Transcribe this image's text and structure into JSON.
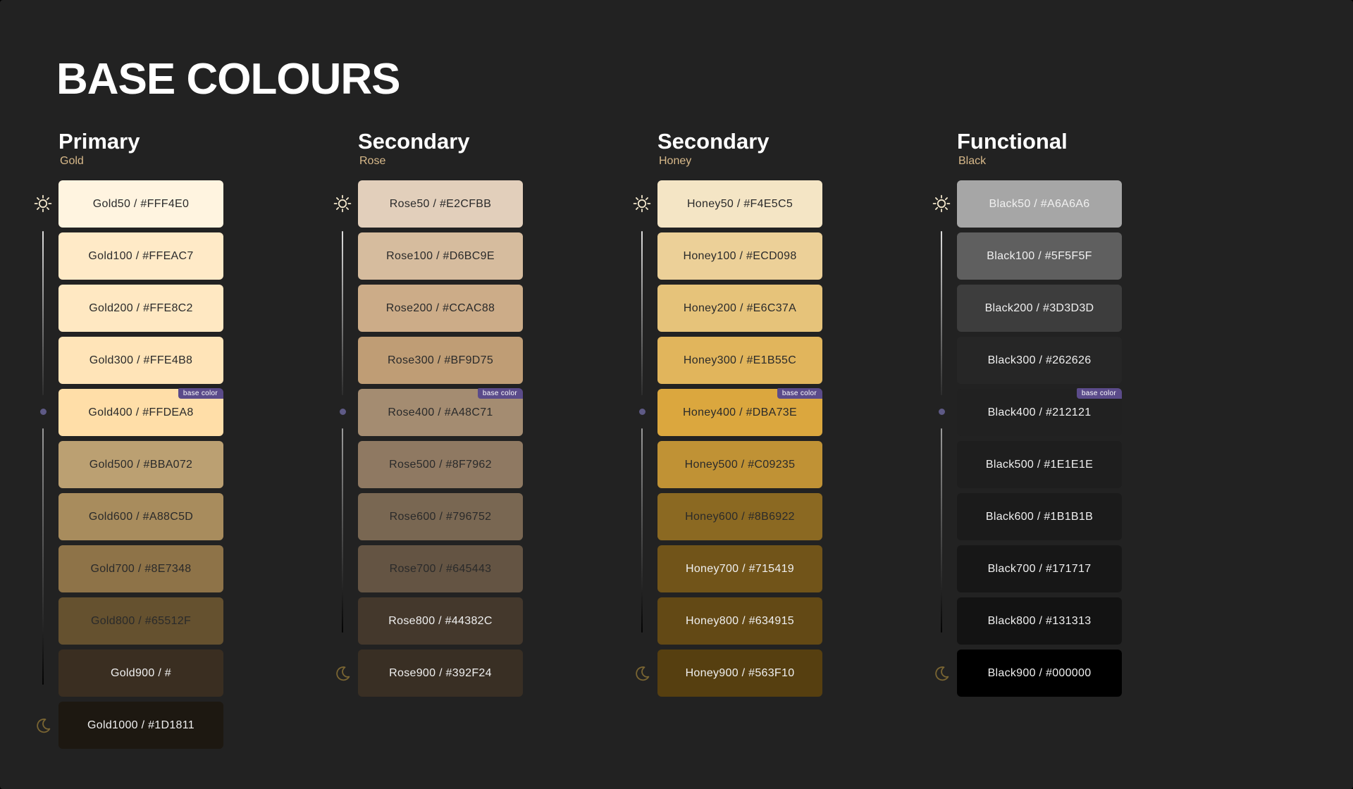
{
  "page": {
    "title": "BASE COLOURS",
    "badge_label": "base color"
  },
  "groups": [
    {
      "title": "Primary",
      "subtitle": "Gold",
      "swatches": [
        {
          "label": "Gold50 / #FFF4E0",
          "color": "#FFF4E0",
          "text": "#2a2a2a",
          "base": false
        },
        {
          "label": "Gold100 / #FFEAC7",
          "color": "#FFEAC7",
          "text": "#2a2a2a",
          "base": false
        },
        {
          "label": "Gold200 / #FFE8C2",
          "color": "#FFE8C2",
          "text": "#2a2a2a",
          "base": false
        },
        {
          "label": "Gold300 / #FFE4B8",
          "color": "#FFE4B8",
          "text": "#2a2a2a",
          "base": false
        },
        {
          "label": "Gold400 / #FFDEA8",
          "color": "#FFDEA8",
          "text": "#2a2a2a",
          "base": true
        },
        {
          "label": "Gold500 / #BBA072",
          "color": "#BBA072",
          "text": "#2a2a2a",
          "base": false
        },
        {
          "label": "Gold600 / #A88C5D",
          "color": "#A88C5D",
          "text": "#2a2a2a",
          "base": false
        },
        {
          "label": "Gold700 / #8E7348",
          "color": "#8E7348",
          "text": "#2a2a2a",
          "base": false
        },
        {
          "label": "Gold800 / #65512F",
          "color": "#65512F",
          "text": "#2a2a2a",
          "base": false
        },
        {
          "label": "Gold900 / #",
          "color": "#3A2E21",
          "text": "#f0f0f0",
          "base": false
        },
        {
          "label": "Gold1000 / #1D1811",
          "color": "#1D1811",
          "text": "#f0f0f0",
          "base": false
        }
      ]
    },
    {
      "title": "Secondary",
      "subtitle": "Rose",
      "swatches": [
        {
          "label": "Rose50 / #E2CFBB",
          "color": "#E2CFBB",
          "text": "#2a2a2a",
          "base": false
        },
        {
          "label": "Rose100 / #D6BC9E",
          "color": "#D6BC9E",
          "text": "#2a2a2a",
          "base": false
        },
        {
          "label": "Rose200 / #CCAC88",
          "color": "#CCAC88",
          "text": "#2a2a2a",
          "base": false
        },
        {
          "label": "Rose300 / #BF9D75",
          "color": "#BF9D75",
          "text": "#2a2a2a",
          "base": false
        },
        {
          "label": "Rose400 / #A48C71",
          "color": "#A48C71",
          "text": "#2a2a2a",
          "base": true
        },
        {
          "label": "Rose500 / #8F7962",
          "color": "#8F7962",
          "text": "#2a2a2a",
          "base": false
        },
        {
          "label": "Rose600 / #796752",
          "color": "#796752",
          "text": "#2a2a2a",
          "base": false
        },
        {
          "label": "Rose700 / #645443",
          "color": "#645443",
          "text": "#2a2a2a",
          "base": false
        },
        {
          "label": "Rose800 / #44382C",
          "color": "#44382C",
          "text": "#f0f0f0",
          "base": false
        },
        {
          "label": "Rose900 / #392F24",
          "color": "#392F24",
          "text": "#f0f0f0",
          "base": false
        }
      ]
    },
    {
      "title": "Secondary",
      "subtitle": "Honey",
      "swatches": [
        {
          "label": "Honey50 / #F4E5C5",
          "color": "#F4E5C5",
          "text": "#2a2a2a",
          "base": false
        },
        {
          "label": "Honey100 / #ECD098",
          "color": "#ECD098",
          "text": "#2a2a2a",
          "base": false
        },
        {
          "label": "Honey200 / #E6C37A",
          "color": "#E6C37A",
          "text": "#2a2a2a",
          "base": false
        },
        {
          "label": "Honey300 / #E1B55C",
          "color": "#E1B55C",
          "text": "#2a2a2a",
          "base": false
        },
        {
          "label": "Honey400 / #DBA73E",
          "color": "#DBA73E",
          "text": "#2a2a2a",
          "base": true
        },
        {
          "label": "Honey500 / #C09235",
          "color": "#C09235",
          "text": "#2a2a2a",
          "base": false
        },
        {
          "label": "Honey600 / #8B6922",
          "color": "#8B6922",
          "text": "#2a2a2a",
          "base": false
        },
        {
          "label": "Honey700 / #715419",
          "color": "#715419",
          "text": "#f0f0f0",
          "base": false
        },
        {
          "label": "Honey800 / #634915",
          "color": "#634915",
          "text": "#f0f0f0",
          "base": false
        },
        {
          "label": "Honey900 / #563F10",
          "color": "#563F10",
          "text": "#f0f0f0",
          "base": false
        }
      ]
    },
    {
      "title": "Functional",
      "subtitle": "Black",
      "swatches": [
        {
          "label": "Black50 / #A6A6A6",
          "color": "#A6A6A6",
          "text": "#f0f0f0",
          "base": false
        },
        {
          "label": "Black100 / #5F5F5F",
          "color": "#5F5F5F",
          "text": "#f0f0f0",
          "base": false
        },
        {
          "label": "Black200 / #3D3D3D",
          "color": "#3D3D3D",
          "text": "#f0f0f0",
          "base": false
        },
        {
          "label": "Black300 / #262626",
          "color": "#262626",
          "text": "#f0f0f0",
          "base": false
        },
        {
          "label": "Black400 / #212121",
          "color": "#212121",
          "text": "#f0f0f0",
          "base": true
        },
        {
          "label": "Black500 / #1E1E1E",
          "color": "#1E1E1E",
          "text": "#f0f0f0",
          "base": false
        },
        {
          "label": "Black600 / #1B1B1B",
          "color": "#1B1B1B",
          "text": "#f0f0f0",
          "base": false
        },
        {
          "label": "Black700 / #171717",
          "color": "#171717",
          "text": "#f0f0f0",
          "base": false
        },
        {
          "label": "Black800 / #131313",
          "color": "#131313",
          "text": "#f0f0f0",
          "base": false
        },
        {
          "label": "Black900 / #000000",
          "color": "#000000",
          "text": "#f0f0f0",
          "base": false
        }
      ]
    }
  ],
  "icons": {
    "light": "sun-icon",
    "dark": "moon-icon"
  },
  "colors": {
    "background": "#222222",
    "subtitle": "#d8b98a",
    "badge": "#5b4b8a",
    "dot": "#5e5a86",
    "sun": "#f3e7cc",
    "moon": "#7a6532"
  }
}
